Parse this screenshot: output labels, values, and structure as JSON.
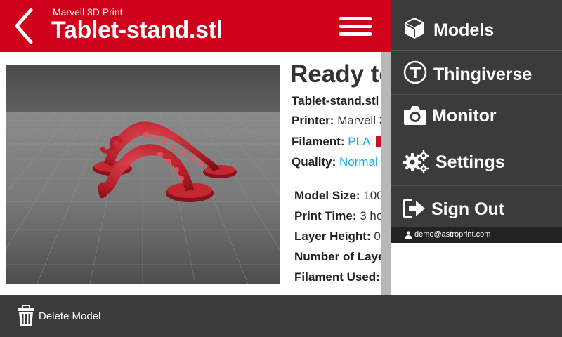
{
  "header": {
    "printer_name": "Marvell 3D Print",
    "file_title": "Tablet-stand.stl"
  },
  "details": {
    "ready_title": "Ready to",
    "file_name": "Tablet-stand.stl",
    "printer_label": "Printer:",
    "printer_value": "Marvell 3",
    "filament_label": "Filament:",
    "filament_value": "PLA",
    "filament_color": "#c0152a",
    "quality_label": "Quality:",
    "quality_value": "Normal",
    "model_size_label": "Model Size:",
    "model_size_value": "100",
    "print_time_label": "Print Time:",
    "print_time_value": "3 ho",
    "layer_height_label": "Layer Height:",
    "layer_height_value": "0.",
    "layers_label": "Number of Laye",
    "filament_used_label": "Filament Used:"
  },
  "footer": {
    "delete_label": "Delete Model"
  },
  "menu": {
    "items": [
      {
        "label": "Models",
        "icon": "cube-icon"
      },
      {
        "label": "Thingiverse",
        "icon": "thingiverse-icon"
      },
      {
        "label": "Monitor",
        "icon": "camera-icon"
      },
      {
        "label": "Settings",
        "icon": "gears-icon"
      },
      {
        "label": "Sign Out",
        "icon": "sign-out-icon"
      }
    ],
    "user_email": "demo@astroprint.com"
  },
  "colors": {
    "header": "#d0021b",
    "menu_bg": "#3b3b3b",
    "link": "#1aa7e0"
  }
}
